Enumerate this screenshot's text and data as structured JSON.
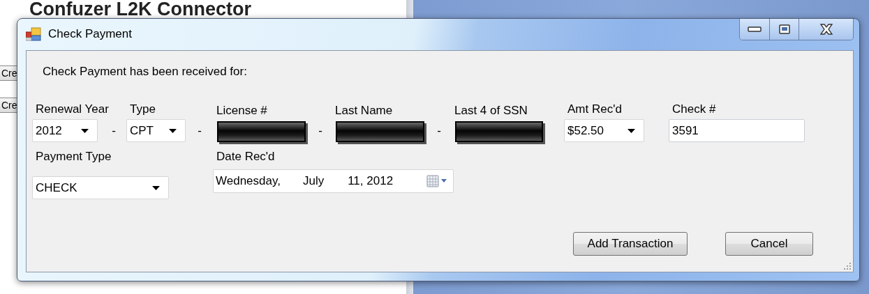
{
  "background_window": {
    "title": "Confuzer L2K Connector",
    "buttons": [
      "Cre",
      "Cre"
    ]
  },
  "dialog": {
    "title": "Check Payment",
    "message": "Check Payment has been received for:",
    "fields_row_1": [
      {
        "kind": "dropdown",
        "label": "Renewal Year",
        "value": "2012"
      },
      {
        "kind": "separator",
        "text": "-"
      },
      {
        "kind": "dropdown",
        "label": "Type",
        "value": "CPT"
      },
      {
        "kind": "separator",
        "text": "-"
      },
      {
        "kind": "redacted",
        "label": "License #"
      },
      {
        "kind": "separator",
        "text": "-"
      },
      {
        "kind": "redacted",
        "label": "Last Name"
      },
      {
        "kind": "separator",
        "text": "-"
      },
      {
        "kind": "redacted",
        "label": "Last 4 of SSN"
      },
      {
        "kind": "dropdown",
        "label": "Amt Rec'd",
        "value": "$52.50"
      },
      {
        "kind": "text",
        "label": "Check #",
        "value": "3591"
      }
    ],
    "fields_row_2": [
      {
        "kind": "dropdown",
        "label": "Payment Type",
        "value": "CHECK"
      },
      {
        "kind": "date",
        "label": "Date Rec'd",
        "weekday": "Wednesday,",
        "month": "July",
        "day_year": "11, 2012"
      }
    ],
    "buttons": [
      "Add Transaction",
      "Cancel"
    ]
  }
}
